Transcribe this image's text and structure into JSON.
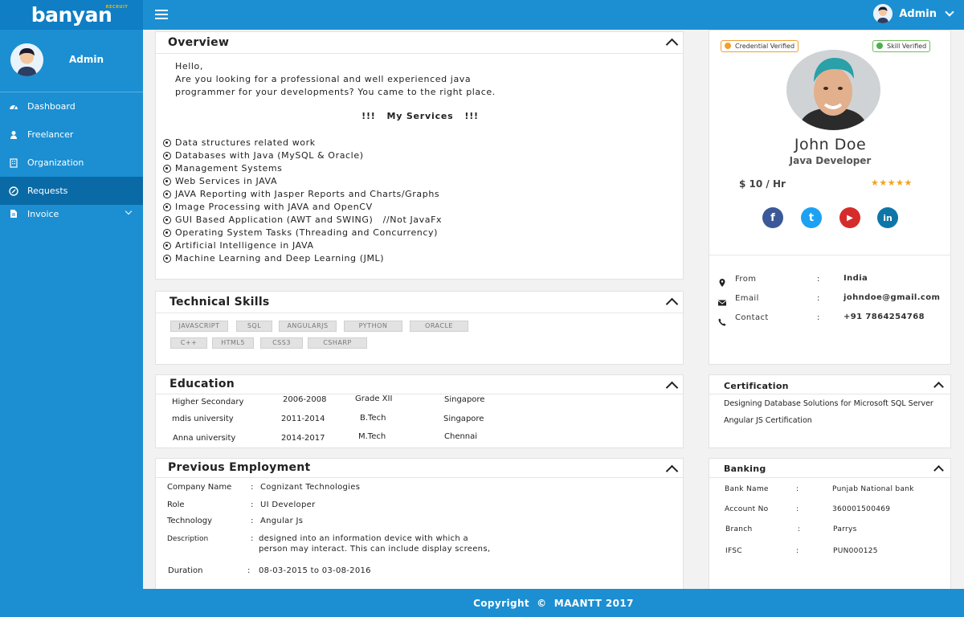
{
  "brand": {
    "name": "banyan",
    "sub": "RECRUIT"
  },
  "topbar": {
    "user": "Admin"
  },
  "sidebar": {
    "user": "Admin",
    "items": [
      {
        "label": "Dashboard",
        "icon": "dashboard-icon"
      },
      {
        "label": "Freelancer",
        "icon": "user-icon"
      },
      {
        "label": "Organization",
        "icon": "building-icon"
      },
      {
        "label": "Requests",
        "icon": "requests-icon",
        "active": true
      },
      {
        "label": "Invoice",
        "icon": "file-icon",
        "expandable": true
      }
    ]
  },
  "overview": {
    "title": "Overview",
    "lines": [
      "Hello,",
      "Are you looking for a professional and well experienced java",
      "programmer for your developments? You came to the right place."
    ],
    "services_heading": "!!!   My Services   !!!",
    "services": [
      "Data structures related work",
      "Databases with Java (MySQL & Oracle)",
      "Management Systems",
      "Web Services in JAVA",
      "JAVA Reporting with Jasper Reports and Charts/Graphs",
      "Image Processing with JAVA and OpenCV",
      "GUI Based Application (AWT and SWING)   //Not JavaFx",
      "Operating System Tasks (Threading and Concurrency)",
      "Artificial Intelligence in JAVA",
      "Machine Learning and Deep Learning (JML)"
    ]
  },
  "skills": {
    "title": "Technical Skills",
    "tags": [
      "JAVASCRIPT",
      "SQL",
      "ANGULARJS",
      "PYTHON",
      "ORACLE",
      "C++",
      "HTML5",
      "CSS3",
      "CSHARP"
    ]
  },
  "education": {
    "title": "Education",
    "rows": [
      [
        "Higher Secondary",
        "2006-2008",
        "Grade XII",
        "Singapore"
      ],
      [
        "mdis university",
        "2011-2014",
        "B.Tech",
        "Singapore"
      ],
      [
        "Anna university",
        "2014-2017",
        "M.Tech",
        "Chennai"
      ]
    ]
  },
  "employment": {
    "title": "Previous Employment",
    "company_label": "Company Name",
    "company": "Cognizant Technologies",
    "role_label": "Role",
    "role": "UI Developer",
    "tech_label": "Technology",
    "tech": "Angular Js",
    "desc_label": "Description",
    "desc_1": "designed into an information device with which a",
    "desc_2": "person may interact. This can include display screens,",
    "duration_label": "Duration",
    "duration": "08-03-2015 to 03-08-2016",
    "colon": ":"
  },
  "profile": {
    "badge_credential": "Credential Verified",
    "badge_skill": "Skill Verified",
    "name": "John Doe",
    "role": "Java Developer",
    "rate": "$ 10 / Hr",
    "stars": "★★★★★",
    "rating": 5,
    "social": [
      "facebook-icon",
      "twitter-icon",
      "youtube-icon",
      "linkedin-icon"
    ],
    "social_glyphs": [
      "f",
      "t",
      "▶",
      "in"
    ],
    "colors": {
      "facebook": "#3b5998",
      "twitter": "#1da1f2",
      "youtube": "#d62b2b",
      "linkedin": "#0e76a8"
    },
    "from_label": "From",
    "from": "India",
    "email_label": "Email",
    "email": "johndoe@gmail.com",
    "contact_label": "Contact",
    "contact": "+91 7864254768",
    "colon": ":"
  },
  "certification": {
    "title": "Certification",
    "items": [
      "Designing Database Solutions for Microsoft SQL Server",
      "Angular JS Certification"
    ]
  },
  "banking": {
    "title": "Banking",
    "bank_label": "Bank Name",
    "bank": "Punjab National bank",
    "account_label": "Account No",
    "account": "360001500469",
    "branch_label": "Branch",
    "branch": "Parrys",
    "ifsc_label": "IFSC",
    "ifsc": "PUN000125",
    "colon": ":"
  },
  "footer": {
    "text": "Copyright  ©  MAANTT 2017"
  },
  "colors": {
    "primary": "#1b8fd2",
    "sidebar_active": "#0a6aa6",
    "brand_dark": "#0f7ec4",
    "accent": "#f6b100"
  }
}
